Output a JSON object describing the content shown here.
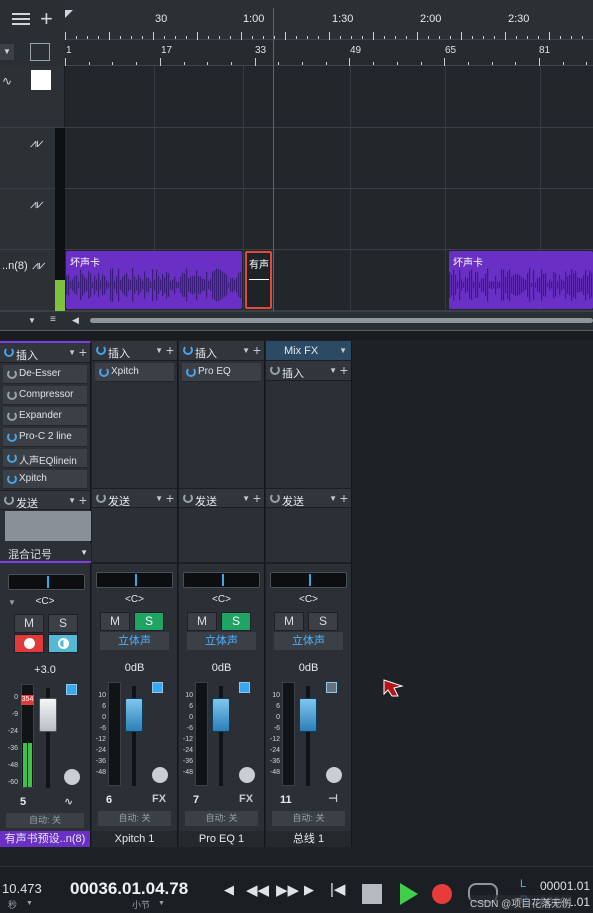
{
  "ruler": {
    "time_labels": [
      "30",
      "1:00",
      "1:30",
      "2:00",
      "2:30"
    ],
    "bar_labels": [
      "1",
      "17",
      "33",
      "49",
      "65",
      "81"
    ]
  },
  "tracks": [
    {
      "head_icon": "wave-icon"
    },
    {
      "head_icon": "wave-icon"
    },
    {
      "head_icon": "wave-icon"
    },
    {
      "head_label": "..n(8)",
      "head_icon": "wave-icon"
    }
  ],
  "clips": [
    {
      "title": "坏声卡"
    },
    {
      "title": "有声"
    },
    {
      "title": "坏声卡"
    }
  ],
  "mixer": {
    "channels": [
      {
        "insert_label": "插入",
        "plugins": [
          "De-Esser",
          "Compressor",
          "Expander",
          "Pro-C 2 line",
          "人声EQlinein",
          "Xpitch"
        ],
        "send_label": "发送",
        "mixing_note": "混合记号",
        "pan": "<C>",
        "mute": "M",
        "solo": "S",
        "gain": "+3.0",
        "peak": "354",
        "number": "5",
        "auto": "自动: 关",
        "name": "有声书预设..n(8)"
      },
      {
        "insert_label": "插入",
        "plugins": [
          "Xpitch"
        ],
        "send_label": "发送",
        "pan": "<C>",
        "mute": "M",
        "solo": "S",
        "stereo": "立体声",
        "gain": "0dB",
        "number": "6",
        "type_icon": "FX",
        "auto": "自动: 关",
        "name": "Xpitch 1"
      },
      {
        "insert_label": "插入",
        "plugins": [
          "Pro EQ"
        ],
        "send_label": "发送",
        "pan": "<C>",
        "mute": "M",
        "solo": "S",
        "stereo": "立体声",
        "gain": "0dB",
        "number": "7",
        "type_icon": "FX",
        "auto": "自动: 关",
        "name": "Pro EQ 1"
      },
      {
        "header": "Mix FX",
        "insert_label": "插入",
        "plugins": [],
        "send_label": "发送",
        "pan": "<C>",
        "mute": "M",
        "solo": "S",
        "stereo": "立体声",
        "gain": "0dB",
        "number": "11",
        "auto": "自动: 关",
        "name": "总线 1"
      }
    ],
    "scale": [
      "10",
      "6",
      "0",
      "-6",
      "-12",
      "-24",
      "-36",
      "-48"
    ],
    "scale_main": [
      "0",
      "-9",
      "-24",
      "-36",
      "-48",
      "-60"
    ]
  },
  "transport": {
    "seconds_value": "10.473",
    "seconds_unit": "秒",
    "position": "00036.01.04.78",
    "position_unit": "小节",
    "loop_l": "L",
    "loop_r": "R",
    "loop_l_value": "00001.01",
    "loop_r_value": "00001.01",
    "watermark": "CSDN @项目花落无伤"
  },
  "colors": {
    "accent": "#3aa8ef",
    "clip": "#6a2fc4",
    "solo": "#1fa463",
    "playhead": "#e0302a"
  }
}
